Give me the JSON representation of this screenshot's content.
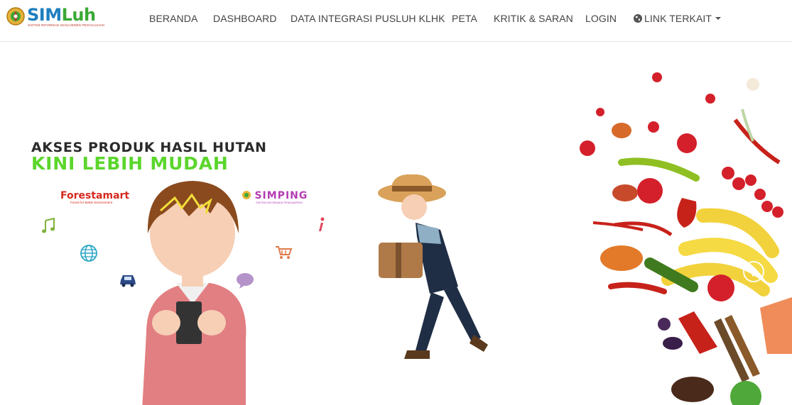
{
  "app": {
    "logo_text": "SIMLuh",
    "logo_subtitle": "SISTEM INFORMASI MANAJEMEN PENYULUHAN"
  },
  "nav": {
    "items": [
      {
        "label": "BERANDA"
      },
      {
        "label": "DASHBOARD"
      },
      {
        "label": "DATA INTEGRASI PUSLUH KLHK"
      },
      {
        "label": "PETA"
      },
      {
        "label": "KRITIK & SARAN"
      },
      {
        "label": "LOGIN"
      },
      {
        "label": "LINK TERKAIT",
        "icon": "globe-icon",
        "dropdown": true
      }
    ]
  },
  "hero": {
    "headline_line1": "AKSES PRODUK HASIL HUTAN",
    "headline_line2": "KINI LEBIH MUDAH",
    "brands": {
      "forestamart": {
        "name": "Forestamart",
        "tagline": "Forest for Better Environment"
      },
      "simping": {
        "name": "SIMPING",
        "tagline": "SISTEM INFORMASI PENDAMPING"
      }
    },
    "slide_control": {
      "icon": "chevron-right-icon"
    }
  },
  "colors": {
    "headline_dark": "#2b2b2b",
    "headline_green": "#5bd62c",
    "nav_text": "#444444",
    "logo_blue": "#1e7fc0",
    "logo_green": "#3aa935"
  }
}
